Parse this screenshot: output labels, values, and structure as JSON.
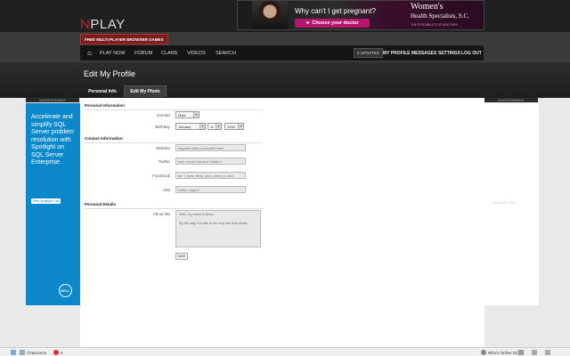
{
  "header": {
    "logo_n": "N",
    "logo_rest": "PLAY",
    "tagline": "FREE MULTI-PLAYER BROWSER GAMES"
  },
  "ad_banner": {
    "question": "Why can't I get pregnant?",
    "button": "► Choose your doctor",
    "brand_line1": "Women's",
    "brand_line2": "Health Specialists, S.C.",
    "tag": "THE POSSIBILITY OF ANOTHER"
  },
  "nav": {
    "home_icon": "home-icon",
    "items": [
      "PLAY NOW",
      "FORUM",
      "CLANS",
      "VIDEOS",
      "SEARCH"
    ],
    "updates": "0 UPDATES",
    "right_items": [
      "MY PROFILE",
      "MESSAGES",
      "SETTINGS",
      "LOG OUT"
    ]
  },
  "page": {
    "title": "Edit My Profile",
    "tabs": [
      "Personal Info",
      "Edit My Photo"
    ]
  },
  "left_ad": {
    "label": "ADVERTISEMENT",
    "text": "Accelerate and simplify SQL Server problem resolution with Spotlight on SQL Server Enterprise.",
    "trial": "Free Spotlight Trial",
    "brand": "DELL"
  },
  "right_ad": {
    "label": "ADVERTISEMENT",
    "text": "Reporting Project"
  },
  "form": {
    "personal_info": "Personal Information",
    "gender_label": "Gender",
    "gender_value": "Male",
    "birthday_label": "Birthday",
    "birth_month": "January",
    "birth_day": "11",
    "birth_year": "1994",
    "contact_info": "Contact Information",
    "website_label": "Website",
    "website_value": "bsgone.wikia.com/wiki/Home",
    "twitter_label": "Twitter",
    "twitter_value": "why would I have a Twitter?",
    "facebook_label": "Facebook",
    "facebook_value": "Its \"i_dont_think_you_need_to_kno",
    "aim_label": "AIM",
    "aim_value": "Reflex Sight?",
    "personal_details": "Personal Details",
    "about_label": "About Me",
    "about_value": "Well, my name is Brian.\n\nBy the way, the wiki is the only site that works.",
    "save": "SAVE"
  },
  "bottombar": {
    "chatrooms": "Chatrooms",
    "chat_count": "4",
    "who_online": "Who's Online (0)"
  }
}
